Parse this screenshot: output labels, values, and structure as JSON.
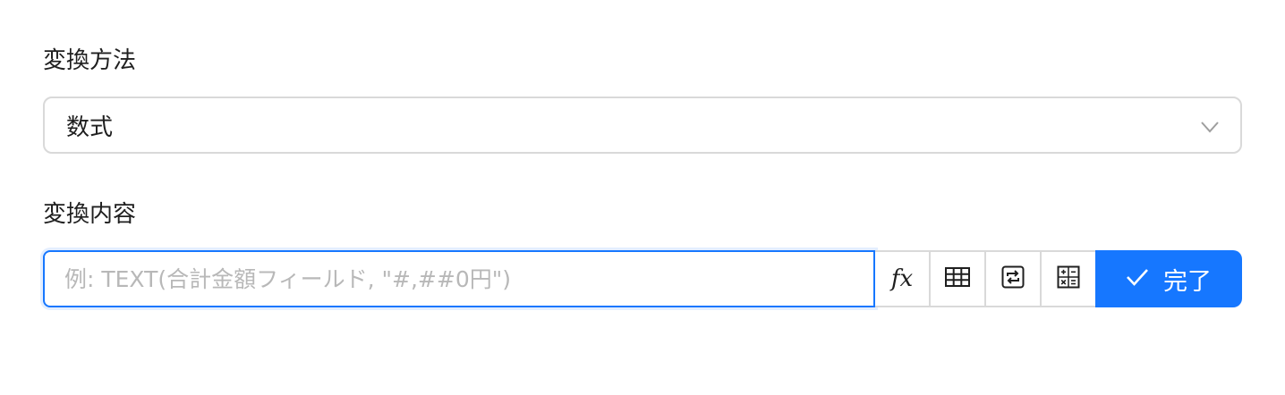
{
  "form": {
    "method_label": "変換方法",
    "method_value": "数式",
    "content_label": "変換内容",
    "content_placeholder": "例: TEXT(合計金額フィールド, \"#,##0円\")",
    "content_value": "",
    "tools": {
      "fx_label": "fx",
      "table_icon": "table-icon",
      "convert_icon": "convert-icon",
      "calculator_icon": "calculator-icon"
    },
    "done_label": "完了"
  },
  "colors": {
    "accent": "#1677ff",
    "border": "#d9d9d9",
    "placeholder": "#b8b8b8",
    "text": "#1f1f1f"
  }
}
